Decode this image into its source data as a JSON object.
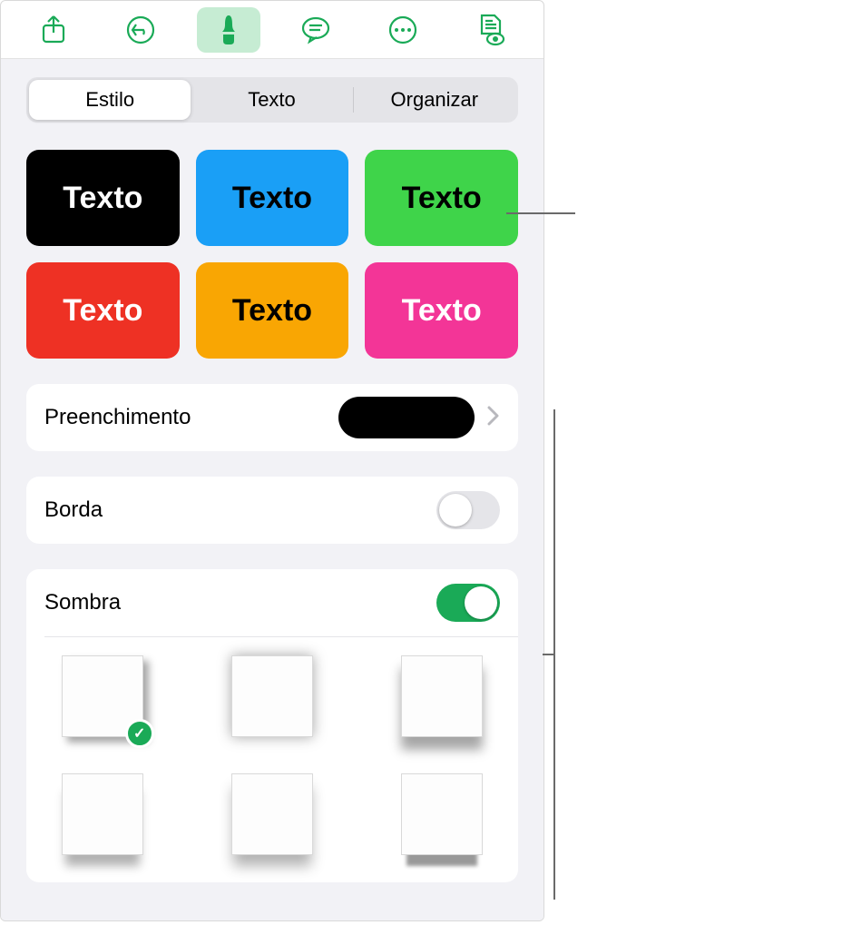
{
  "toolbar": {
    "share_icon": "share",
    "undo_icon": "undo",
    "format_icon": "brush",
    "insert_icon": "text-bubble",
    "more_icon": "more",
    "document_icon": "document-view"
  },
  "tabs": {
    "style": "Estilo",
    "text": "Texto",
    "arrange": "Organizar",
    "active": "style"
  },
  "presets": [
    {
      "label": "Texto",
      "bg": "#000000",
      "fg": "#ffffff"
    },
    {
      "label": "Texto",
      "bg": "#1a9ff6",
      "fg": "#000000"
    },
    {
      "label": "Texto",
      "bg": "#3fd44a",
      "fg": "#000000"
    },
    {
      "label": "Texto",
      "bg": "#ee3124",
      "fg": "#ffffff"
    },
    {
      "label": "Texto",
      "bg": "#f9a603",
      "fg": "#000000"
    },
    {
      "label": "Texto",
      "bg": "#f33597",
      "fg": "#ffffff"
    }
  ],
  "fill": {
    "label": "Preenchimento",
    "swatch_color": "#000000"
  },
  "border": {
    "label": "Borda",
    "enabled": false
  },
  "shadow": {
    "label": "Sombra",
    "enabled": true,
    "selected": 0,
    "options": [
      {
        "style": "box-shadow: 6px 6px 8px rgba(0,0,0,0.35);"
      },
      {
        "style": "box-shadow: 0 0 14px rgba(0,0,0,0.35);"
      },
      {
        "style": "filter: drop-shadow(0 14px 6px rgba(0,0,0,0.35));"
      },
      {
        "style": "box-shadow: 0 16px 10px -4px rgba(0,0,0,0.3);"
      },
      {
        "style": "box-shadow: 0 14px 14px -2px rgba(0,0,0,0.3);"
      },
      {
        "style": "box-shadow: 0 18px 4px -6px rgba(0,0,0,0.4);"
      }
    ]
  }
}
